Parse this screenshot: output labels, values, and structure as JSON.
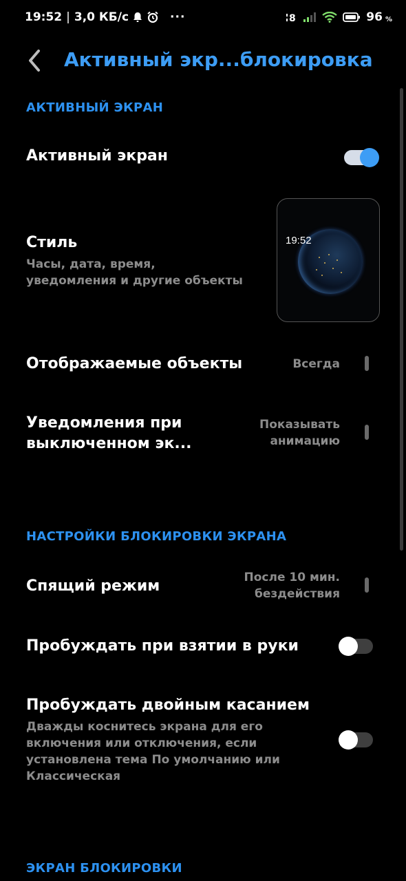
{
  "status_bar": {
    "time": "19:52",
    "speed": "3,0 КБ/с",
    "more": "···",
    "battery_percent": "96",
    "percent_sign": "%"
  },
  "header": {
    "title": "Активный экр...блокировка"
  },
  "sections": {
    "active_screen": "АКТИВНЫЙ ЭКРАН",
    "lock_settings": "НАСТРОЙКИ БЛОКИРОВКИ ЭКРАНА",
    "lock_screen": "ЭКРАН БЛОКИРОВКИ"
  },
  "items": {
    "active_screen": {
      "title": "Активный экран",
      "enabled": true
    },
    "style": {
      "title": "Стиль",
      "subtitle_1": "Часы, дата, время,",
      "subtitle_2": "уведомления и другие объекты",
      "preview_time": "19:52"
    },
    "displayed_objects": {
      "title": "Отображаемые объекты",
      "value": "Всегда"
    },
    "notifications": {
      "title_1": "Уведомления при",
      "title_2": "выключенном эк...",
      "value_1": "Показывать",
      "value_2": "анимацию"
    },
    "sleep": {
      "title": "Спящий режим",
      "value_1": "После 10 мин.",
      "value_2": "бездействия"
    },
    "wake_pickup": {
      "title": "Пробуждать при взятии в руки",
      "enabled": false
    },
    "wake_double_tap": {
      "title": "Пробуждать двойным касанием",
      "subtitle_1": "Дважды коснитесь экрана для его",
      "subtitle_2": "включения или отключения, если",
      "subtitle_3": "установлена тема По умолчанию или",
      "subtitle_4": "Классическая",
      "enabled": false
    }
  },
  "colors": {
    "accent": "#3d9df5",
    "section": "#2d91f0",
    "secondary_text": "#8c8c8c"
  }
}
